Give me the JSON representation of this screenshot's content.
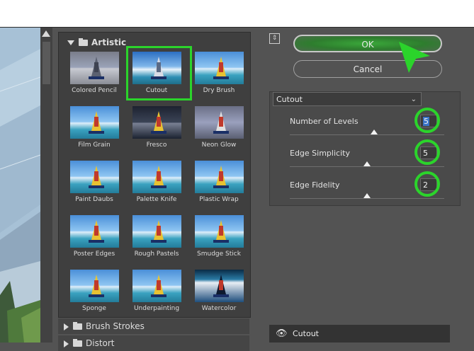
{
  "gallery": {
    "open_category": "Artistic",
    "filters": [
      "Colored Pencil",
      "Cutout",
      "Dry Brush",
      "Film Grain",
      "Fresco",
      "Neon Glow",
      "Paint Daubs",
      "Palette Knife",
      "Plastic Wrap",
      "Poster Edges",
      "Rough Pastels",
      "Smudge Stick",
      "Sponge",
      "Underpainting",
      "Watercolor"
    ],
    "selected_filter": "Cutout",
    "collapsed_categories": [
      "Brush Strokes",
      "Distort"
    ]
  },
  "buttons": {
    "ok_label": "OK",
    "cancel_label": "Cancel"
  },
  "settings": {
    "filter_select_value": "Cutout",
    "params": [
      {
        "label": "Number of Levels",
        "value": "5"
      },
      {
        "label": "Edge Simplicity",
        "value": "5"
      },
      {
        "label": "Edge Fidelity",
        "value": "2"
      }
    ]
  },
  "effect_layer": {
    "name": "Cutout"
  },
  "colors": {
    "highlight": "#2bd42b",
    "panel_bg": "#535353",
    "ok_button": "#3aa83a"
  },
  "icons": [
    "zoom-toggle-icon",
    "folder-icon",
    "eye-icon",
    "chevron-down-icon",
    "scroll-up-icon"
  ]
}
